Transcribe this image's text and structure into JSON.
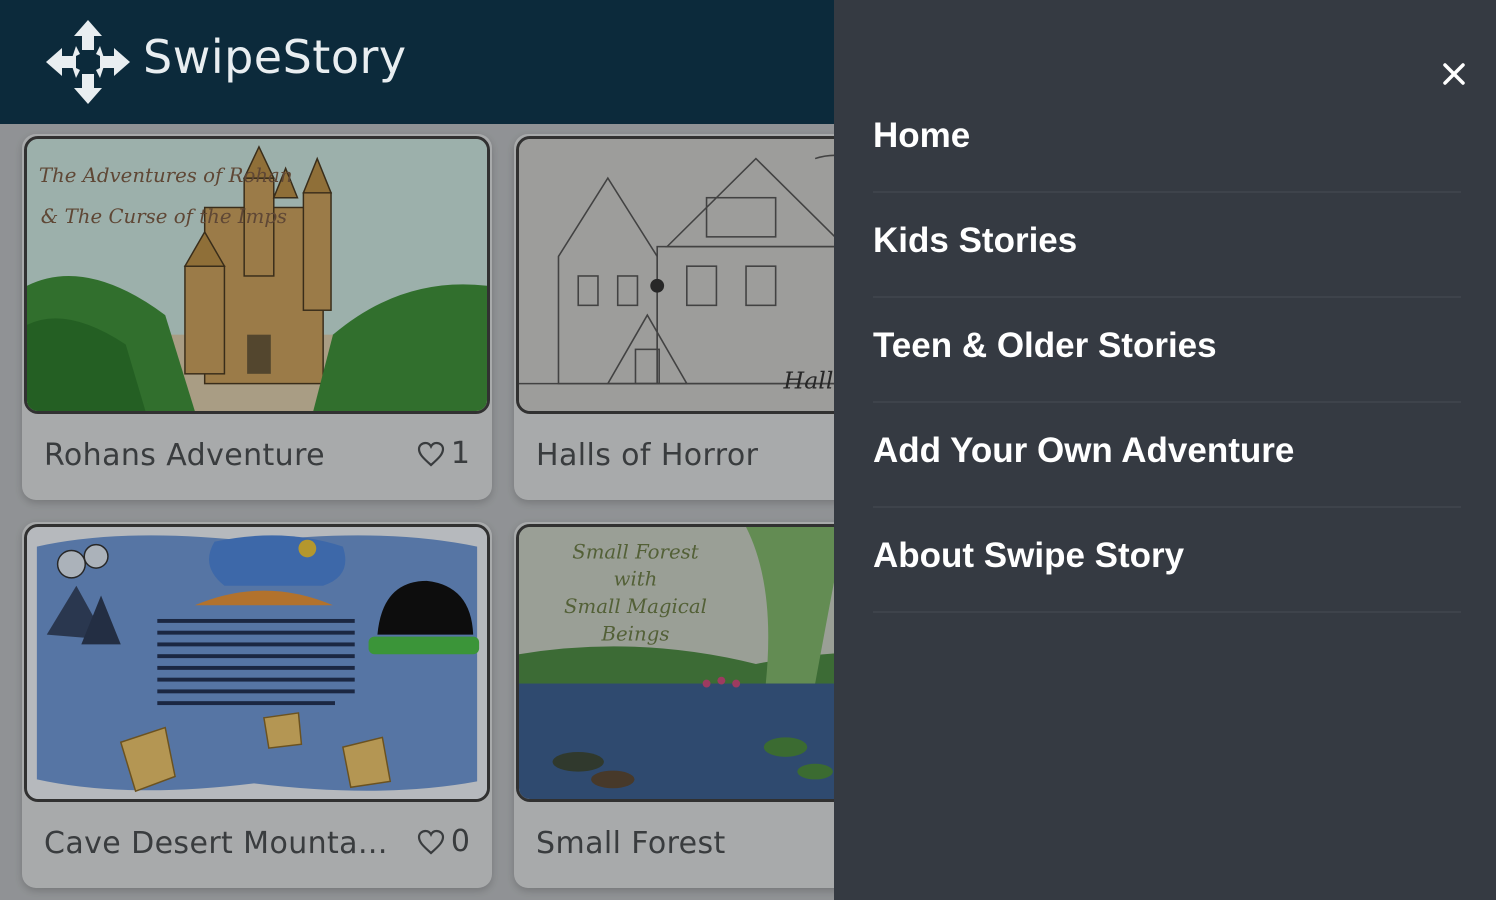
{
  "app": {
    "brand": "SwipeStory",
    "logo_icon": "four-arrows-move-icon"
  },
  "stories": [
    {
      "title": "Rohans Adventure",
      "likes": "1",
      "cover": "castle-cover"
    },
    {
      "title": "Halls of Horror",
      "cover": "haunted-house-sketch-cover"
    },
    {
      "title": "Cave Desert Mounta...",
      "likes": "0",
      "cover": "map-collage-cover"
    },
    {
      "title": "Small Forest",
      "cover": "forest-pond-cover"
    }
  ],
  "covers": {
    "rohans": {
      "script_line_1": "The Adventures of Rohan",
      "script_line_2": "& The Curse of the Imps"
    },
    "forest": {
      "line_1": "Small Forest",
      "line_2": "with",
      "line_3": "Small Magical",
      "line_4": "Beings"
    },
    "halls": {
      "sign": "Hall"
    }
  },
  "drawer": {
    "close_icon": "close-icon",
    "menu": [
      {
        "label": "Home"
      },
      {
        "label": "Kids Stories"
      },
      {
        "label": "Teen & Older Stories"
      },
      {
        "label": "Add Your Own Adventure"
      },
      {
        "label": "About Swipe Story"
      }
    ]
  },
  "colors": {
    "header": "#0c2a3b",
    "drawer": "#353a42",
    "menu_text": "#ffffff"
  }
}
